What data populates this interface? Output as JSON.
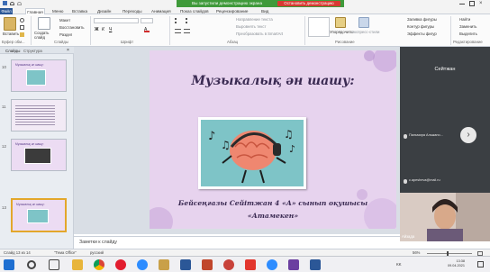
{
  "share_banner": {
    "text": "Вы запустили демонстрацию экрана",
    "stop_button": "Остановить демонстрацию"
  },
  "ribbon": {
    "tabs": [
      "Файл",
      "Главная",
      "Меню",
      "Вставка",
      "Дизайн",
      "Переходы",
      "Анимация",
      "Показ слайдов",
      "Рецензирование",
      "Вид"
    ],
    "clipboard": {
      "paste": "Вставить",
      "group": "Буфер обм..."
    },
    "slides": {
      "new_slide": "Создать слайд",
      "layout": "Макет",
      "reset": "Восстановить",
      "section": "Раздел",
      "group": "Слайды"
    },
    "font_group": "Шрифт",
    "paragraph": {
      "direction": "Направление текста",
      "align": "Выровнять текст",
      "smartart": "Преобразовать в SmartArt",
      "group": "Абзац"
    },
    "drawing": {
      "arrange": "Упорядочить",
      "quick_styles": "Экспресс-стили",
      "fill": "Заливка фигуры",
      "outline": "Контур фигуры",
      "effects": "Эффекты фигур",
      "group": "Рисование"
    },
    "editing": {
      "find": "Найти",
      "replace": "Заменить",
      "select": "Выделить",
      "group": "Редактирование"
    }
  },
  "left_panel": {
    "tab_slides": "Слайды",
    "tab_outline": "Структура",
    "thumbs": [
      {
        "num": "10",
        "title": "Музыкалық ән шашу:"
      },
      {
        "num": "11",
        "title": ""
      },
      {
        "num": "12",
        "title": "Музыкалық ән шашу:"
      },
      {
        "num": "13",
        "title": "Музыкалық ән шашу:"
      }
    ]
  },
  "slide": {
    "title": "Музыкалық ән шашу:",
    "line1": "Бейсеңғазы Сейітжан 4 «А» сынып оқушысы",
    "line2": "«Атамекен»"
  },
  "notes": {
    "placeholder": "Заметки к слайду"
  },
  "participants": {
    "top_name": "Сейтжан",
    "rows": [
      "Пальмира Альжано...",
      "c.apesheva@mail.ru"
    ],
    "webcam_name": "Айзада"
  },
  "status": {
    "slide_counter": "Слайд 13 из 14",
    "theme": "\"Тема Office\"",
    "language": "русский",
    "zoom": "56%"
  },
  "taskbar": {
    "lang": "KK",
    "time": "13:38",
    "date": "09.04.2021"
  },
  "colors": {
    "share_green": "#3f9a3a",
    "stop_red": "#d73a32",
    "slide_bg": "#e7d3ee",
    "slide_text": "#3a2a52",
    "picture_bg": "#7ec4c7",
    "brain": "#ef8770"
  }
}
